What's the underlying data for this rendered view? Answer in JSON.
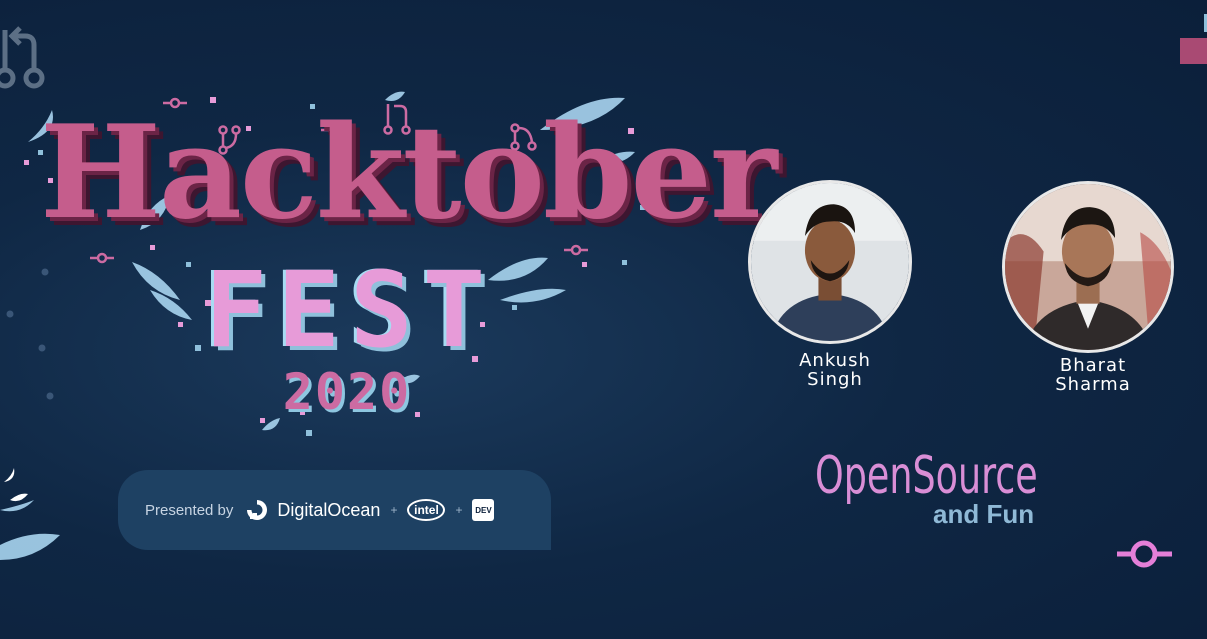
{
  "event": {
    "title_line1": "Hacktober",
    "title_line2": "FEST",
    "year": "2020"
  },
  "sponsors": {
    "presented_by": "Presented by",
    "digitalocean": "DigitalOcean",
    "separator": "+",
    "intel": "intel",
    "dev": "DEV"
  },
  "speakers": [
    {
      "first": "Ankush",
      "last": "Singh"
    },
    {
      "first": "Bharat",
      "last": "Sharma"
    }
  ],
  "tagline": {
    "line1": "OpenSource",
    "line2": "and Fun"
  },
  "colors": {
    "background": "#0b1f3a",
    "pink": "#c55d8c",
    "light_pink": "#e79bd8",
    "light_blue": "#8fc0db",
    "bar": "#1e4163"
  },
  "icons": [
    "git-pull-request-icon",
    "git-merge-icon",
    "git-commit-icon",
    "leaf-icon",
    "digitalocean-logo",
    "intel-logo",
    "dev-logo"
  ]
}
